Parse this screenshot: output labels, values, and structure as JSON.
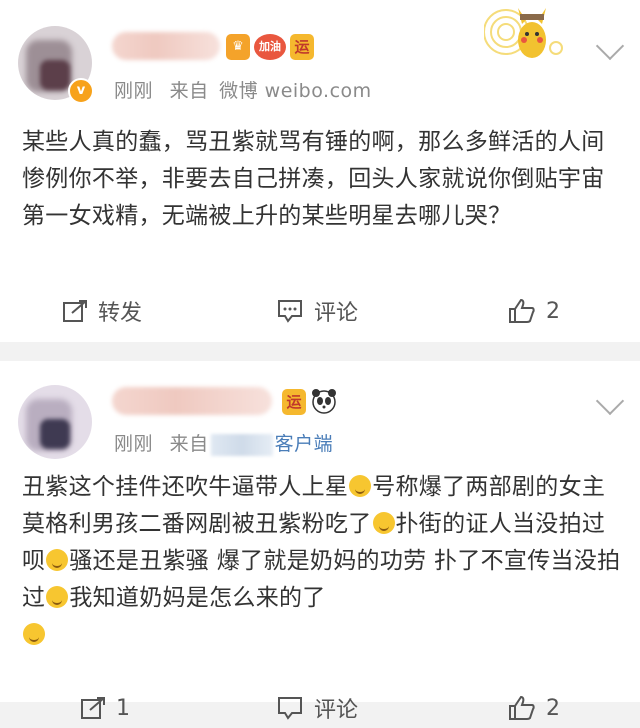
{
  "posts": [
    {
      "time": "刚刚",
      "source_prefix": "来自",
      "source": "微博 weibo.com",
      "badges": [
        "加油",
        "运"
      ],
      "content": "某些人真的蠢，骂丑紫就骂有锤的啊，那么多鲜活的人间惨例你不举，非要去自己拼凑，回头人家就说你倒贴宇宙第一女戏精，无端被上升的某些明星去哪儿哭？",
      "actions": {
        "repost": "转发",
        "comment": "评论",
        "like_count": "2"
      }
    },
    {
      "time": "刚刚",
      "source_prefix": "来自",
      "source": "客户端",
      "badges": [
        "运"
      ],
      "content_parts": [
        "丑紫这个挂件还吹牛逼带人上星",
        "号称爆了两部剧的女主 莫格利男孩二番网剧被丑紫粉吃了",
        "扑街的证人当没拍过呗",
        "骚还是丑紫骚 爆了就是奶妈的功劳 扑了不宣传当没拍过",
        "我知道奶妈是怎么来的了",
        ""
      ],
      "actions": {
        "repost": "1",
        "comment": "评论",
        "like_count": "2"
      }
    }
  ],
  "colors": {
    "link": "#4a7db8",
    "meta": "#8a8a8a",
    "vip_orange": "#f7a21b"
  }
}
